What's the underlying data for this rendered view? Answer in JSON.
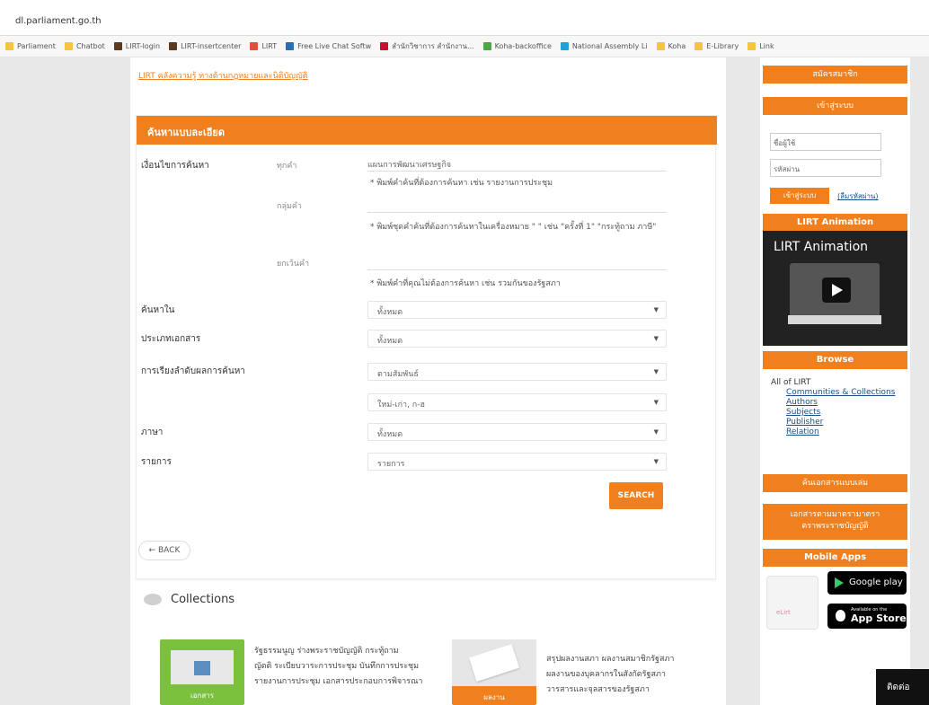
{
  "browser": {
    "url": "dl.parliament.go.th",
    "bookmarks": [
      {
        "label": "Parliament",
        "color": "#f2c53d"
      },
      {
        "label": "Chatbot",
        "color": "#f2c53d"
      },
      {
        "label": "LIRT-login",
        "color": "#5b3a20"
      },
      {
        "label": "LIRT-insertcenter",
        "color": "#5b3a20"
      },
      {
        "label": "LIRT",
        "color": "#e0503a"
      },
      {
        "label": "Free Live Chat Softw",
        "color": "#2b6db0"
      },
      {
        "label": "สำนักวิชาการ สำนักงาน...",
        "color": "#c8102e"
      },
      {
        "label": "Koha-backoffice",
        "color": "#49a942"
      },
      {
        "label": "National Assembly Li",
        "color": "#1fa2d6"
      },
      {
        "label": "Koha",
        "color": "#f2c53d"
      },
      {
        "label": "E-Library",
        "color": "#f2c53d"
      },
      {
        "label": "Link",
        "color": "#f2c53d"
      }
    ]
  },
  "top_link": "LIRT คลังความรู้ ทางด้านกฎหมายและนิติบัญญัติ",
  "search_panel": {
    "title": "ค้นหาแบบละเอียด",
    "condition_label": "เงื่อนไขการค้นหา",
    "all_words_label": "ทุกคำ",
    "all_words_value": "แผนการพัฒนาเศรษฐกิจ",
    "all_words_hint": "* พิมพ์คำค้นที่ต้องการค้นหา เช่น รายงานการประชุม",
    "phrase_label": "กลุ่มคำ",
    "phrase_hint": "* พิมพ์ชุดคำค้นที่ต้องการค้นหาในเครื่องหมาย \" \" เช่น \"ครั้งที่ 1\" \"กระทู้ถาม ภาษี\"",
    "exclude_label": "ยกเว้นคำ",
    "exclude_hint": "* พิมพ์คำที่คุณไม่ต้องการค้นหา เช่น รวมกันของรัฐสภา",
    "search_in_label": "ค้นหาใน",
    "search_in_value": "ทั้งหมด",
    "doctype_label": "ประเภทเอกสาร",
    "doctype_value": "ทั้งหมด",
    "sort_label": "การเรียงลำดับผลการค้นหา",
    "sort_value": "ตามสัมพันธ์",
    "order_value": "ใหม่-เก่า, ก-ฮ",
    "lang_label": "ภาษา",
    "lang_value": "ทั้งหมด",
    "items_label": "รายการ",
    "items_value": "รายการ",
    "search_button": "SEARCH"
  },
  "back_button": "← BACK",
  "collections": {
    "title": "Collections",
    "card1_caption": "เอกสาร",
    "card1_text": [
      "รัฐธรรมนูญ ร่างพระราชบัญญัติ กระทู้ถาม",
      "ญัตติ ระเบียบวาระการประชุม บันทึกการประชุม",
      "รายงานการประชุม เอกสารประกอบการพิจารณา"
    ],
    "card2_caption": "ผลงาน",
    "card2_text": [
      "สรุปผลงานสภา ผลงานสมาชิกรัฐสภา",
      "ผลงานของบุคลากรในสังกัดรัฐสภา",
      "วารสารและจุลสารของรัฐสภา"
    ]
  },
  "sidebar": {
    "register": "สมัครสมาชิก",
    "login_head": "เข้าสู่ระบบ",
    "username_placeholder": "ชื่อผู้ใช้",
    "password_placeholder": "รหัสผ่าน",
    "login_button": "เข้าสู่ระบบ",
    "forgot_link": "(ลืมรหัสผ่าน)",
    "animation_head": "LIRT Animation",
    "video_title": "LIRT Animation",
    "browse_head": "Browse",
    "browse_items": [
      "All of LIRT",
      "Communities & Collections",
      "Authors",
      "Subjects",
      "Publisher",
      "Relation"
    ],
    "doc_search": "ค้นเอกสารแบบเล่ม",
    "law_docs": [
      "เอกสารตามมาตรามาตรา",
      "ตราพระราชบัญญัติ"
    ],
    "mobile_head": "Mobile Apps",
    "app_icon_text": "eLirt",
    "google_play": "Google play",
    "app_store_small": "Available on the",
    "app_store": "App Store"
  },
  "chat_label": "ติดต่อ"
}
